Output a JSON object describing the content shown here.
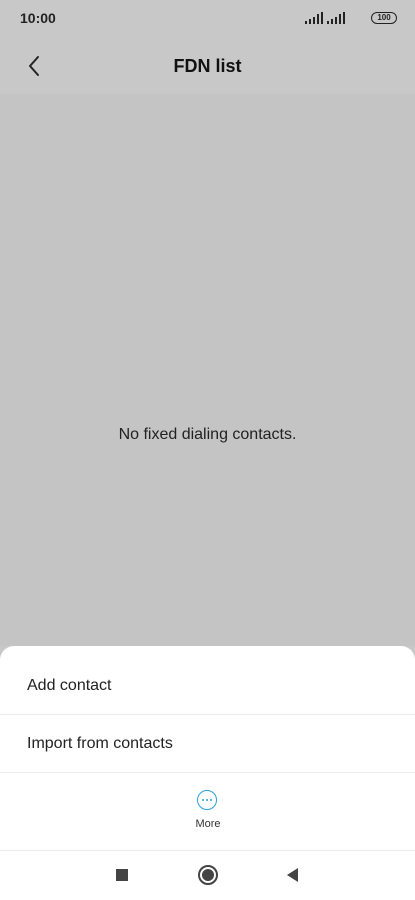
{
  "status_bar": {
    "time": "10:00",
    "battery_level": "100",
    "icons": [
      "signal-icon",
      "signal-icon",
      "battery-icon"
    ]
  },
  "header": {
    "title": "FDN list",
    "back_icon": "chevron-left-icon"
  },
  "content": {
    "empty_message": "No fixed dialing contacts."
  },
  "sheet": {
    "items": [
      {
        "label": "Add contact"
      },
      {
        "label": "Import from contacts"
      }
    ],
    "more": {
      "label": "More",
      "icon": "more-horizontal-icon"
    }
  },
  "nav_bar": {
    "icons": [
      "recents-square-icon",
      "home-circle-icon",
      "back-triangle-icon"
    ]
  },
  "colors": {
    "scrim": "#c4c4c4",
    "accent": "#2aa0d4",
    "sheet": "#ffffff"
  }
}
